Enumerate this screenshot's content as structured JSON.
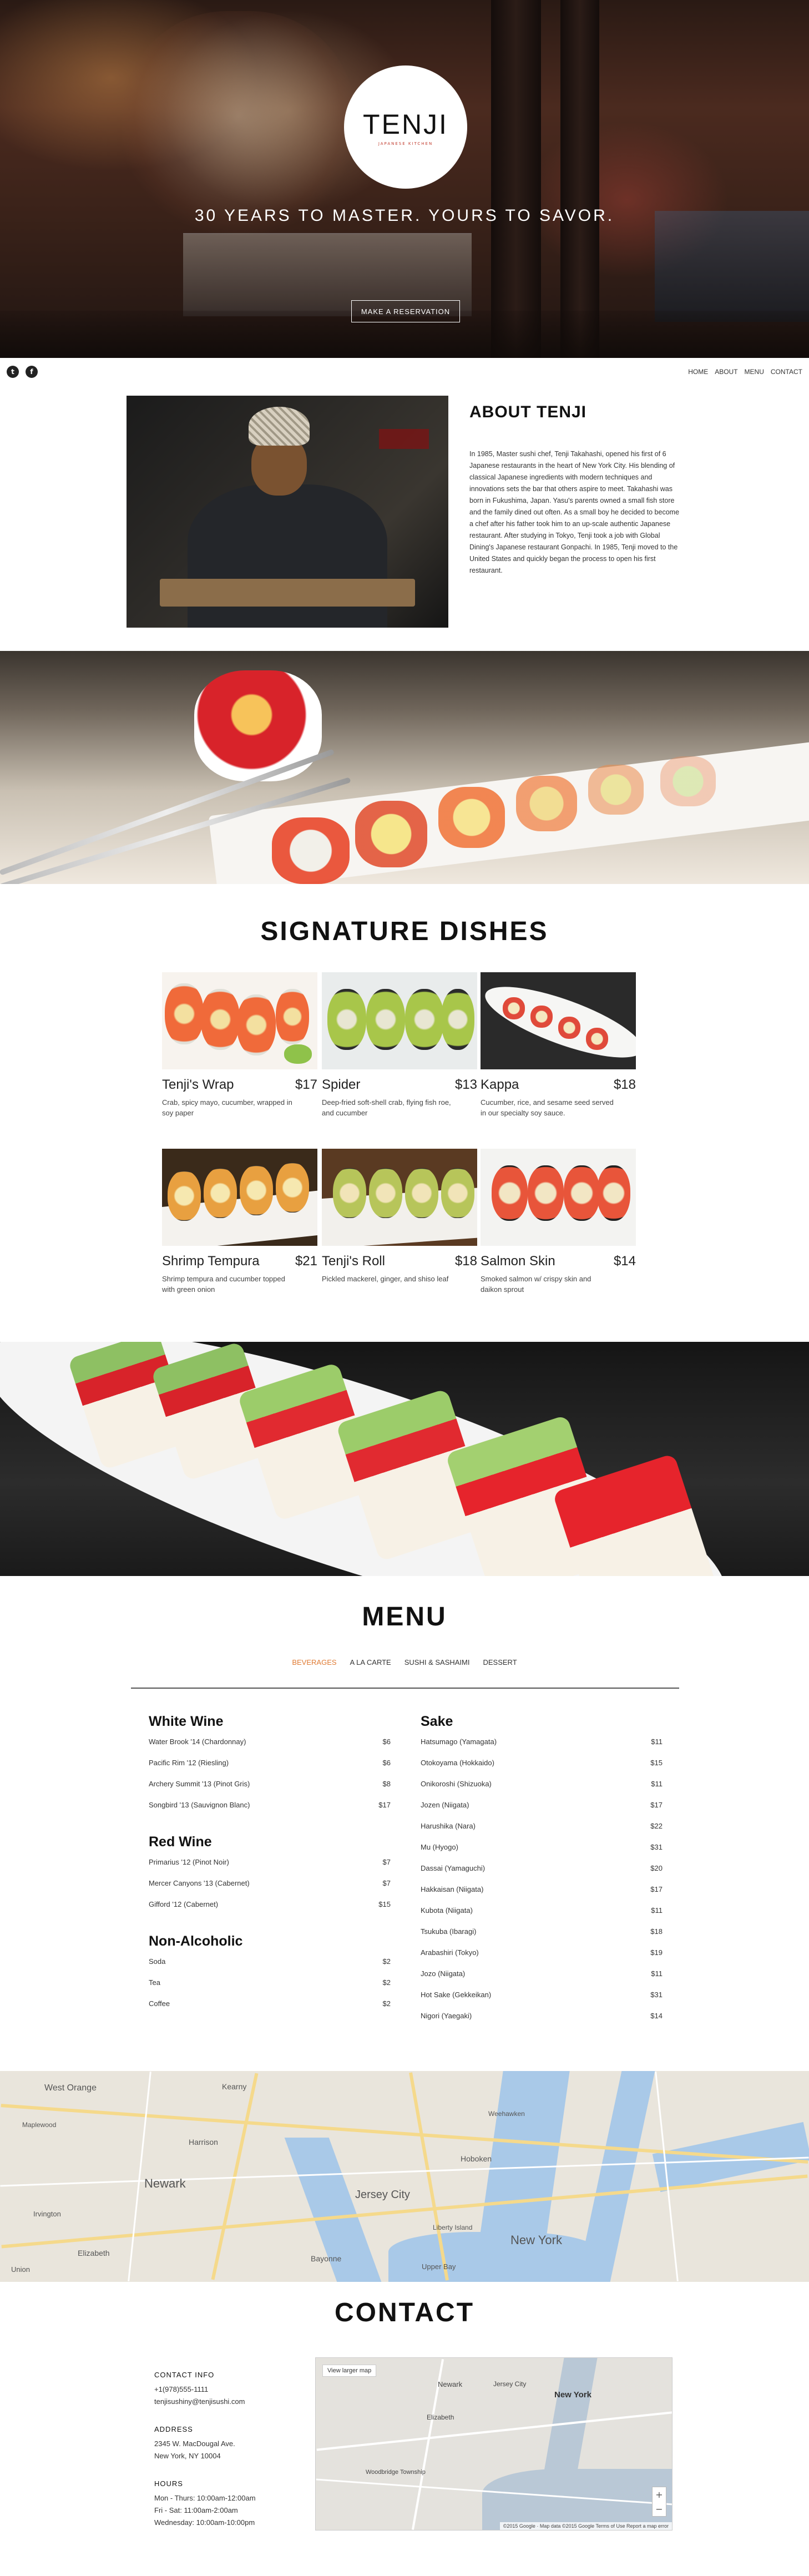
{
  "hero": {
    "logo_name": "TENJI",
    "logo_sub": "JAPANESE KITCHEN",
    "tagline": "30 YEARS TO MASTER. YOURS TO SAVOR.",
    "reserve_label": "MAKE A RESERVATION"
  },
  "social": {
    "twitter": "t",
    "facebook": "f"
  },
  "nav": {
    "home": "HOME",
    "about": "ABOUT",
    "menu": "MENU",
    "contact": "CONTACT"
  },
  "about": {
    "title": "ABOUT TENJI",
    "text": "In 1985, Master sushi chef, Tenji Takahashi, opened his first of 6 Japanese restaurants in the heart of New York City. His blending of classical Japanese ingredients with modern techniques and innovations sets the bar that others aspire to meet. Takahashi was born in Fukushima, Japan. Yasu's parents owned a small fish store and the family dined out often. As a small boy he decided to become a chef after his father took him to an up-scale authentic Japanese restaurant. After studying in Tokyo, Tenji took a job with Global Dining's Japanese restaurant Gonpachi. In 1985, Tenji moved to the United States and quickly began the process to open his first restaurant."
  },
  "signature": {
    "title": "SIGNATURE DISHES",
    "dishes": [
      {
        "name": "Tenji's Wrap",
        "price": "$17",
        "desc": "Crab, spicy mayo, cucumber, wrapped in soy paper"
      },
      {
        "name": "Spider",
        "price": "$13",
        "desc": "Deep-fried soft-shell crab, flying fish roe, and cucumber"
      },
      {
        "name": "Kappa",
        "price": "$18",
        "desc": "Cucumber, rice, and sesame seed served in our specialty soy sauce."
      },
      {
        "name": "Shrimp Tempura",
        "price": "$21",
        "desc": "Shrimp tempura and cucumber topped with green onion"
      },
      {
        "name": "Tenji's Roll",
        "price": "$18",
        "desc": "Pickled mackerel, ginger, and shiso leaf"
      },
      {
        "name": "Salmon Skin",
        "price": "$14",
        "desc": "Smoked salmon w/ crispy skin and daikon sprout"
      }
    ]
  },
  "menu": {
    "title": "MENU",
    "tabs": [
      "BEVERAGES",
      "A LA CARTE",
      "SUSHI & SASHAIMI",
      "DESSERT"
    ],
    "left": [
      {
        "category": "White Wine",
        "items": [
          {
            "name": "Water Brook '14 (Chardonnay)",
            "price": "$6"
          },
          {
            "name": "Pacific Rim '12 (Riesling)",
            "price": "$6"
          },
          {
            "name": "Archery Summit '13 (Pinot Gris)",
            "price": "$8"
          },
          {
            "name": "Songbird '13 (Sauvignon Blanc)",
            "price": "$17"
          }
        ]
      },
      {
        "category": "Red Wine",
        "items": [
          {
            "name": "Primarius '12 (Pinot Noir)",
            "price": "$7"
          },
          {
            "name": "Mercer Canyons '13 (Cabernet)",
            "price": "$7"
          },
          {
            "name": "Gifford '12 (Cabernet)",
            "price": "$15"
          }
        ]
      },
      {
        "category": "Non-Alcoholic",
        "items": [
          {
            "name": "Soda",
            "price": "$2"
          },
          {
            "name": "Tea",
            "price": "$2"
          },
          {
            "name": "Coffee",
            "price": "$2"
          }
        ]
      }
    ],
    "right": [
      {
        "category": "Sake",
        "items": [
          {
            "name": "Hatsumago (Yamagata)",
            "price": "$11"
          },
          {
            "name": "Otokoyama (Hokkaido)",
            "price": "$15"
          },
          {
            "name": "Onikoroshi (Shizuoka)",
            "price": "$11"
          },
          {
            "name": "Jozen (Niigata)",
            "price": "$17"
          },
          {
            "name": "Harushika (Nara)",
            "price": "$22"
          },
          {
            "name": "Mu (Hyogo)",
            "price": "$31"
          },
          {
            "name": "Dassai (Yamaguchi)",
            "price": "$20"
          },
          {
            "name": "Hakkaisan (Niigata)",
            "price": "$17"
          },
          {
            "name": "Kubota (Niigata)",
            "price": "$11"
          },
          {
            "name": "Tsukuba (Ibaragi)",
            "price": "$18"
          },
          {
            "name": "Arabashiri (Tokyo)",
            "price": "$19"
          },
          {
            "name": "Jozo (Niigata)",
            "price": "$11"
          },
          {
            "name": "Hot Sake (Gekkeikan)",
            "price": "$31"
          },
          {
            "name": "Nigori (Yaegaki)",
            "price": "$14"
          }
        ]
      }
    ]
  },
  "map": {
    "labels": [
      "West Orange",
      "Kearny",
      "Harrison",
      "Newark",
      "Jersey City",
      "Hoboken",
      "New York",
      "Liberty Island",
      "Bayonne",
      "Elizabeth",
      "Irvington",
      "Union",
      "Maplewood",
      "Weehawken",
      "Upper Bay"
    ]
  },
  "contact": {
    "title": "CONTACT",
    "info_head": "CONTACT INFO",
    "phone": "+1(978)555-1111",
    "email": "tenjisushiny@tenjisushi.com",
    "address_head": "ADDRESS",
    "address1": "2345 W. MacDougal Ave.",
    "address2": "New York, NY 10004",
    "hours_head": "HOURS",
    "hours1": "Mon - Thurs: 10:00am-12:00am",
    "hours2": "Fri - Sat: 11:00am-2:00am",
    "hours3": "Wednesday: 10:00am-10:00pm",
    "map_larger": "View larger map",
    "map_attrib": "©2015 Google · Map data ©2015 Google    Terms of Use    Report a map error",
    "map_labels": [
      "Newark",
      "New York",
      "Elizabeth",
      "Jersey City",
      "Woodbridge Township"
    ]
  }
}
